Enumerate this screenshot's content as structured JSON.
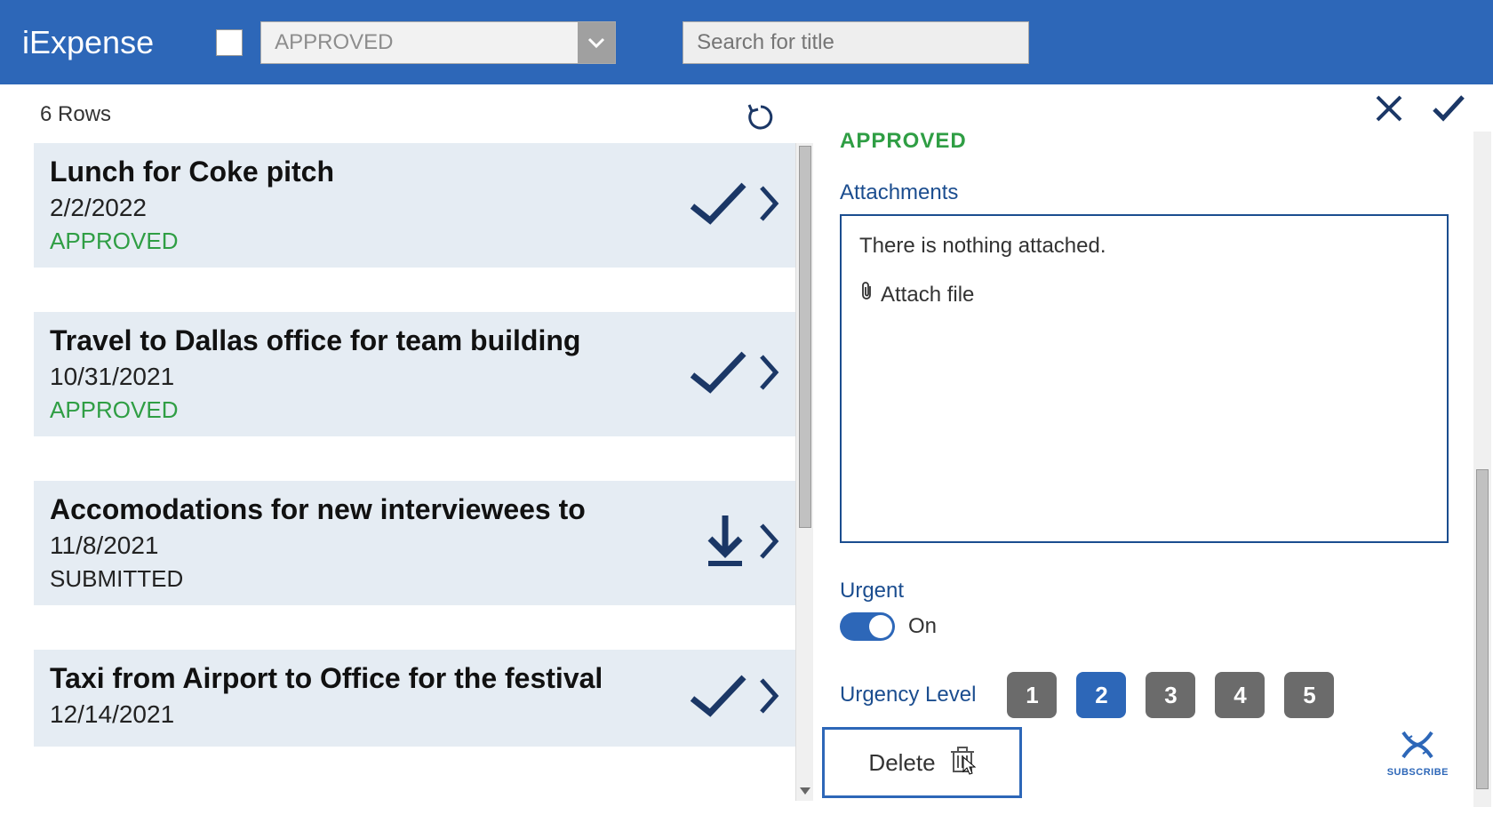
{
  "app": {
    "title": "iExpense"
  },
  "header": {
    "filter_value": "APPROVED",
    "search_placeholder": "Search for title"
  },
  "list": {
    "rows_label": "6 Rows",
    "rows": [
      {
        "title": "Lunch for Coke pitch",
        "date": "2/2/2022",
        "status": "APPROVED",
        "status_kind": "approved",
        "icon": "check"
      },
      {
        "title": "Travel to Dallas office for team building",
        "date": "10/31/2021",
        "status": "APPROVED",
        "status_kind": "approved",
        "icon": "check"
      },
      {
        "title": "Accomodations for new interviewees to",
        "date": "11/8/2021",
        "status": "SUBMITTED",
        "status_kind": "submitted",
        "icon": "download"
      },
      {
        "title": "Taxi from Airport to Office for the festival",
        "date": "12/14/2021",
        "status": "",
        "status_kind": "none",
        "icon": "check"
      }
    ]
  },
  "detail": {
    "status": "APPROVED",
    "attachments_label": "Attachments",
    "attachments_empty": "There is nothing attached.",
    "attach_file_label": "Attach file",
    "urgent_label": "Urgent",
    "urgent_state_label": "On",
    "urgency_label": "Urgency Level",
    "urgency_levels": [
      "1",
      "2",
      "3",
      "4",
      "5"
    ],
    "urgency_selected": "2",
    "delete_label": "Delete"
  },
  "subscribe": {
    "label": "SUBSCRIBE"
  }
}
